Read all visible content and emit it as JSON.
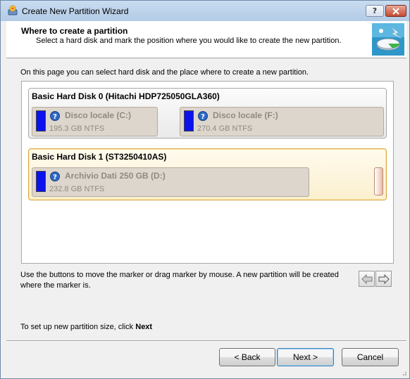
{
  "window": {
    "title": "Create New Partition Wizard",
    "help_label": "?",
    "close_label": "X"
  },
  "header": {
    "title": "Where to create a partition",
    "subtitle": "Select a hard disk and mark the position where you would like to create the new partition."
  },
  "intro": "On this page you can select hard disk and the place where to create a new partition.",
  "disks": [
    {
      "name": "Basic Hard Disk 0 (Hitachi HDP725050GLA360)",
      "partitions": [
        {
          "name": "Disco locale (C:)",
          "size": "195.3 GB NTFS"
        },
        {
          "name": "Disco locale (F:)",
          "size": "270.4 GB NTFS"
        }
      ]
    },
    {
      "name": "Basic Hard Disk 1 (ST3250410AS)",
      "selected": true,
      "partitions": [
        {
          "name": "Archivio Dati 250 GB (D:)",
          "size": "232.8 GB NTFS"
        }
      ]
    }
  ],
  "hint": "Use the buttons to move the marker or drag marker by mouse. A new partition will be created where the marker is.",
  "footer": {
    "text": "To set up new partition size, click",
    "bold": "Next"
  },
  "buttons": {
    "back": "< Back",
    "next": "Next >",
    "cancel": "Cancel"
  },
  "colors": {
    "partition_bar": "#0a12ee",
    "selected_border": "#d8a640",
    "selected_fill": "#fbefce"
  }
}
